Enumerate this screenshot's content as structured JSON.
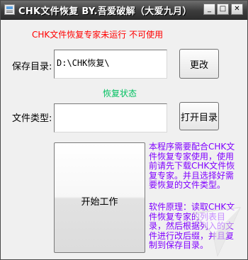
{
  "window": {
    "title": "CHK文件恢复 BY.吾爱破解（大爱九月）",
    "controls": {
      "minimize": "_",
      "maximize": "□",
      "close": "✕"
    }
  },
  "status": {
    "warning": "CHK文件恢复专家未运行  不可使用",
    "restore_state": "恢复状态"
  },
  "form": {
    "save_dir_label": "保存目录:",
    "save_dir_value": "D:\\CHK恢复\\",
    "file_type_label": "文件类型:",
    "file_type_value": ""
  },
  "buttons": {
    "change": "更改",
    "open_dir": "打开目录",
    "start": "开始工作"
  },
  "info": {
    "note1": "本程序需要配合CHK文件恢复专家使用，使用前请先下载CHK文件恢复专家。并且选择好需要恢复的文件类型。",
    "note2": "软件原理：读取CHK文件恢复专家的列表目录，然后根据列入的文件进行改后缀，并且复制到保存目录。"
  },
  "colors": {
    "warning": "#ff0000",
    "restore_state": "#00c060",
    "info": "#8000ff"
  }
}
